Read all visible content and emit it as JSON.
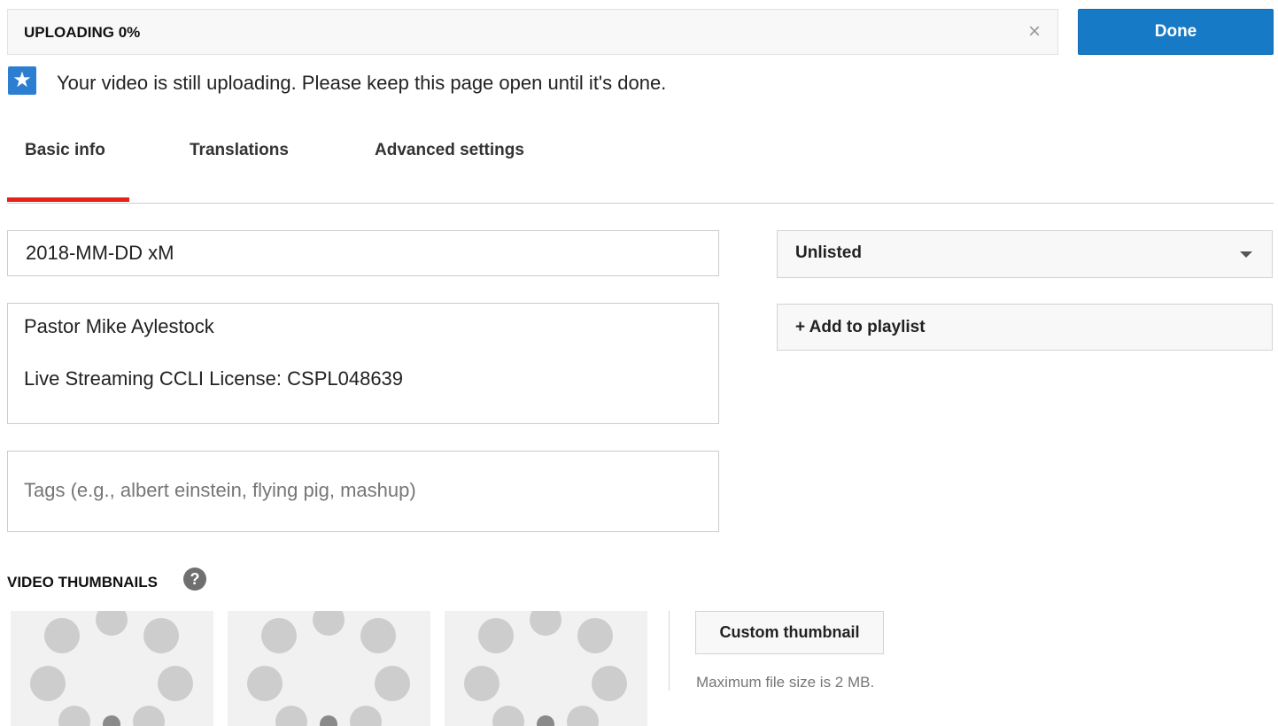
{
  "upload": {
    "status": "UPLOADING 0%",
    "progress_percent": 0,
    "close_symbol": "×",
    "done_label": "Done"
  },
  "notice": {
    "icon": "star-icon",
    "icon_glyph": "★",
    "text": "Your video is still uploading. Please keep this page open until it's done."
  },
  "tabs": [
    {
      "label": "Basic info",
      "active": true
    },
    {
      "label": "Translations",
      "active": false
    },
    {
      "label": "Advanced settings",
      "active": false
    }
  ],
  "form": {
    "title_value": "2018-MM-DD xM",
    "description_lines": [
      "Pastor Mike Aylestock",
      "Live Streaming CCLI License: CSPL048639"
    ],
    "tags_placeholder": "Tags (e.g., albert einstein, flying pig, mashup)"
  },
  "privacy": {
    "selected": "Unlisted"
  },
  "playlist": {
    "label": "+ Add to playlist"
  },
  "thumbnails": {
    "heading": "VIDEO THUMBNAILS",
    "help_glyph": "?",
    "custom_button_label": "Custom thumbnail",
    "max_size_note": "Maximum file size is 2 MB."
  },
  "colors": {
    "accent_blue": "#167ac6",
    "tab_underline_red": "#e62117",
    "notice_icon_blue": "#2c7fd0"
  }
}
